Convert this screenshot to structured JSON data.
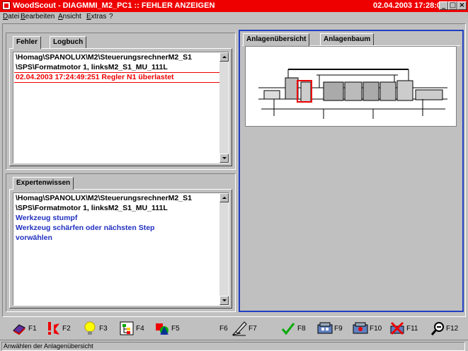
{
  "window": {
    "title": "WoodScout - DIAGMMI_M2_PC1 :: FEHLER ANZEIGEN",
    "datetime": "02.04.2003 17:28:08",
    "controls": [
      "_",
      "□",
      "×"
    ]
  },
  "menu": [
    "Datei",
    "Bearbeiten",
    "Ansicht",
    "Extras",
    "?"
  ],
  "left_top": {
    "tabs": [
      "Fehler",
      "Logbuch"
    ],
    "lines": [
      "\\Homag\\SPANOLUX\\M2\\SteuerungsrechnerM2_S1",
      "\\SPS\\Formatmotor 1, linksM2_S1_MU_111L",
      "02.04.2003 17:24:49:251   Regler N1 überlastet"
    ]
  },
  "left_bottom": {
    "tabs": [
      "Expertenwissen"
    ],
    "lines": [
      "\\Homag\\SPANOLUX\\M2\\SteuerungsrechnerM2_S1",
      "\\SPS\\Formatmotor 1, linksM2_S1_MU_111L",
      "Werkzeug stumpf",
      "Werkzeug schärfen oder nächsten Step",
      "vorwählen"
    ]
  },
  "right": {
    "tabs": [
      "Anlagenübersicht",
      "Anlagenbaum"
    ]
  },
  "fkeys": [
    {
      "label": "F1",
      "icon": "book-icon"
    },
    {
      "label": "F2",
      "icon": "exclamation-icon"
    },
    {
      "label": "F3",
      "icon": "lightbulb-icon"
    },
    {
      "label": "F4",
      "icon": "tree-icon"
    },
    {
      "label": "F5",
      "icon": "shapes-icon"
    },
    {
      "label": "F6",
      "icon": ""
    },
    {
      "label": "F7",
      "icon": "pen-hand-icon"
    },
    {
      "label": "F8",
      "icon": "checkmark-icon"
    },
    {
      "label": "F9",
      "icon": "machine-icon"
    },
    {
      "label": "F10",
      "icon": "machine-zoom-icon"
    },
    {
      "label": "F11",
      "icon": "red-x-icon"
    },
    {
      "label": "F12",
      "icon": "magnifier-icon"
    }
  ],
  "status": "Anwählen der Anlagenübersicht",
  "colors": {
    "titlebar": "#ee0000",
    "error_text": "#ee0000",
    "expert_text": "#2030c0",
    "focus_border": "#2040c0"
  }
}
